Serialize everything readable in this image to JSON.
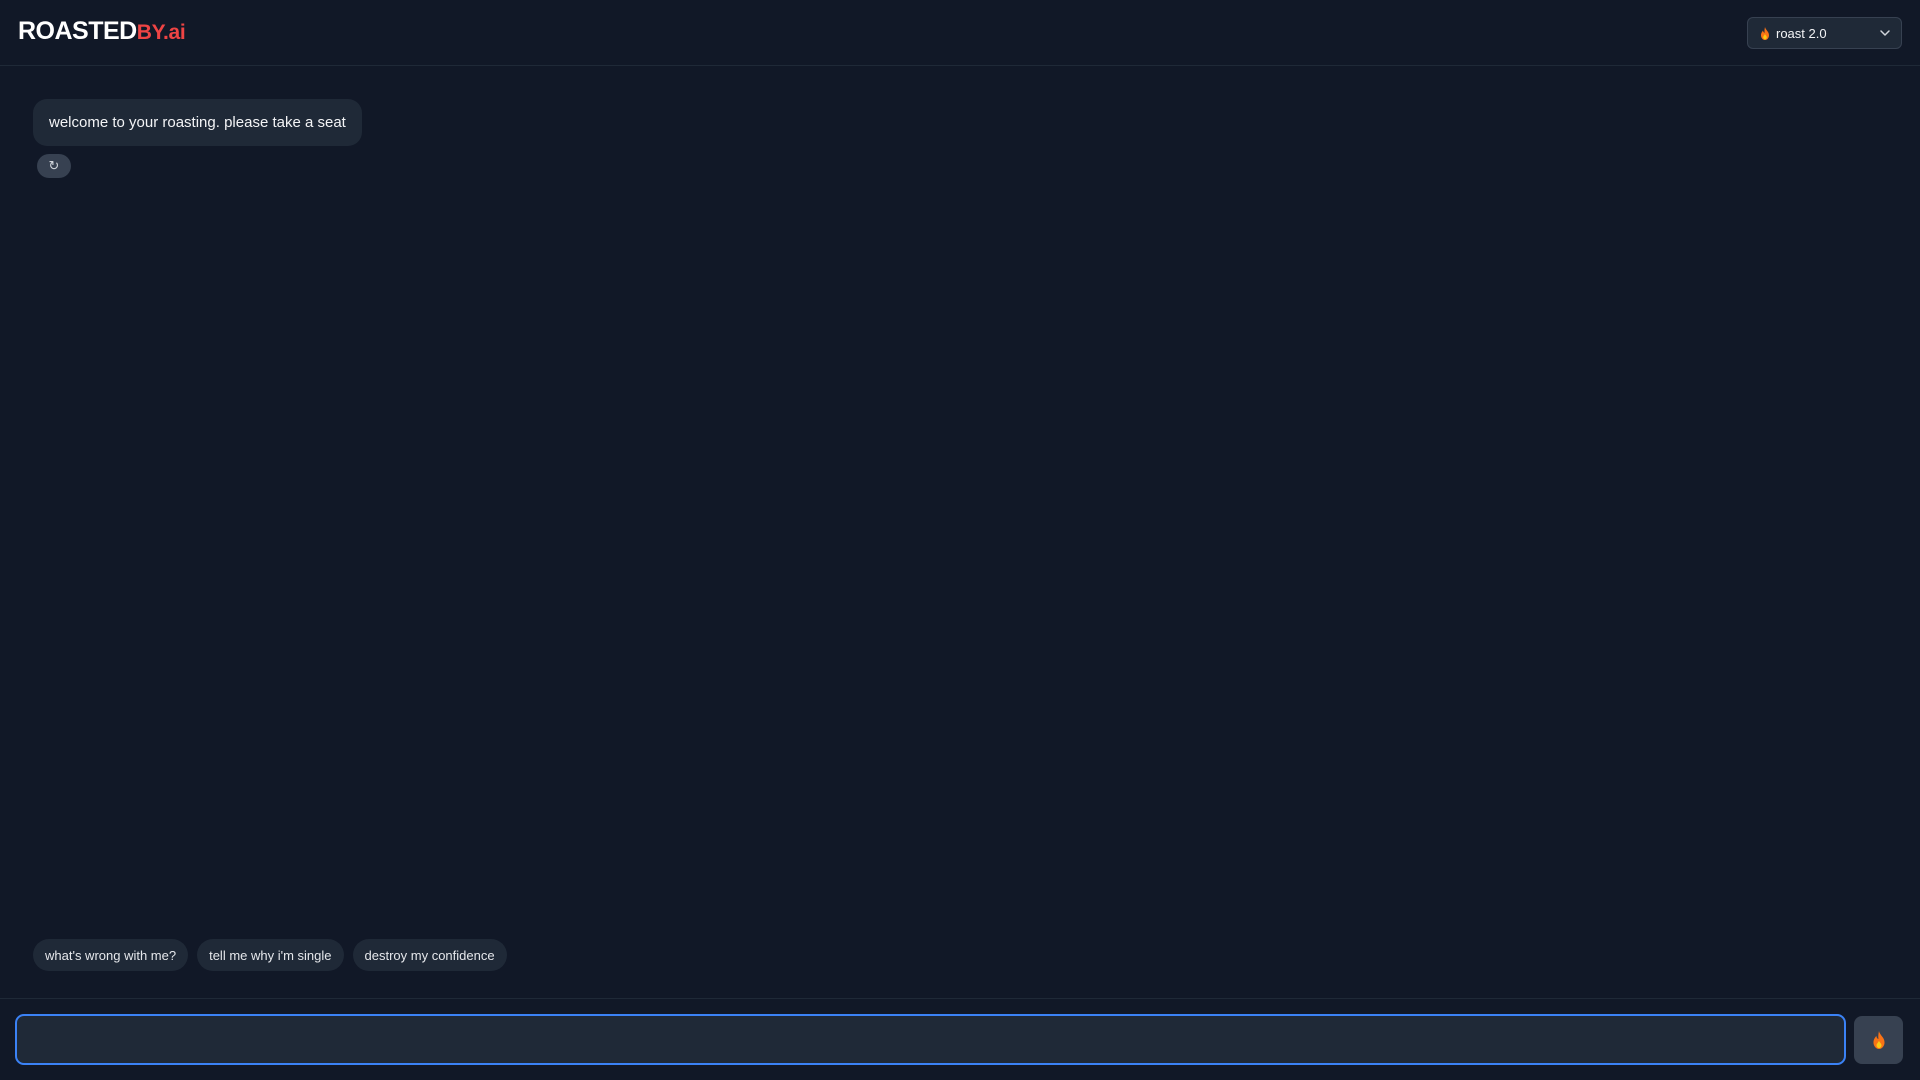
{
  "header": {
    "logo_main": "ROASTED",
    "logo_suffix": "BY.ai",
    "model_select": {
      "selected": "roast 2.0",
      "icon": "flame-icon",
      "chevron": "chevron-down-icon"
    }
  },
  "chat": {
    "messages": [
      {
        "role": "assistant",
        "text": "welcome to your roasting. please take a seat"
      }
    ],
    "regenerate_glyph": "↻"
  },
  "suggestions": [
    {
      "label": "what's wrong with me?"
    },
    {
      "label": "tell me why i'm single"
    },
    {
      "label": "destroy my confidence"
    }
  ],
  "composer": {
    "value": "",
    "placeholder": "",
    "send_icon": "flame-icon"
  },
  "colors": {
    "background": "#111827",
    "surface": "#1f2937",
    "accent_red": "#ef4444",
    "focus_blue": "#3b82f6"
  }
}
